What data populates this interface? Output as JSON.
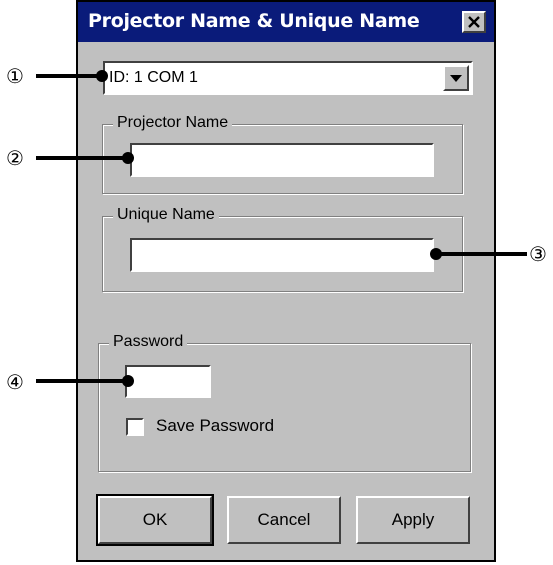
{
  "dialog": {
    "title": "Projector Name & Unique Name",
    "combo_value": "ID:  1 COM 1",
    "projector_group_label": "Projector Name",
    "projector_name_value": "",
    "unique_group_label": "Unique Name",
    "unique_name_value": "",
    "password_group_label": "Password",
    "password_value": "",
    "save_password_label": "Save Password",
    "save_password_checked": false,
    "ok_label": "OK",
    "cancel_label": "Cancel",
    "apply_label": "Apply"
  },
  "callouts": [
    "①",
    "②",
    "③",
    "④"
  ],
  "icons": {
    "close": "close-x-icon",
    "dropdown": "chevron-down-icon"
  }
}
